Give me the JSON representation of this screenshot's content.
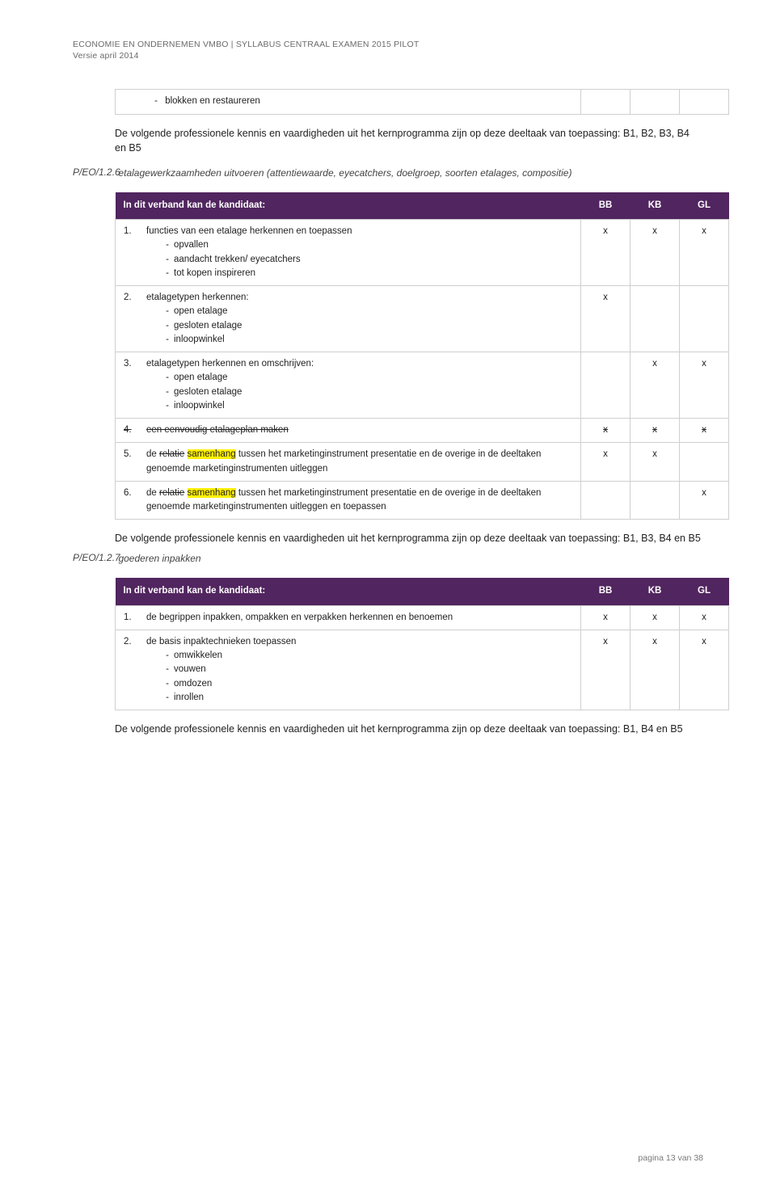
{
  "header": {
    "line1": "ECONOMIE EN ONDERNEMEN  VMBO | SYLLABUS CENTRAAL EXAMEN 2015 PILOT",
    "line2": "Versie april 2014"
  },
  "preblock": {
    "bullet1": "blokken en restaureren",
    "para": "De volgende professionele kennis en vaardigheden uit het kernprogramma zijn op deze deeltaak van toepassing: B1, B2, B3, B4 en B5"
  },
  "section126": {
    "code": "P/EO/1.2.6",
    "title": "etalagewerkzaamheden uitvoeren (attentiewaarde, eyecatchers, doelgroep, soorten etalages, compositie)"
  },
  "table_header": {
    "label": "In dit verband kan de kandidaat:",
    "col_bb": "BB",
    "col_kb": "KB",
    "col_gl": "GL"
  },
  "x": "x",
  "t126": {
    "r1": {
      "num": "1.",
      "text": "functies van een etalage herkennen en toepassen",
      "sub1": "opvallen",
      "sub2": "aandacht trekken/ eyecatchers",
      "sub3": "tot kopen inspireren",
      "bb": "x",
      "kb": "x",
      "gl": "x"
    },
    "r2": {
      "num": "2.",
      "text": "etalagetypen herkennen:",
      "sub1": "open etalage",
      "sub2": "gesloten etalage",
      "sub3": "inloopwinkel",
      "bb": "x",
      "kb": "",
      "gl": ""
    },
    "r3": {
      "num": "3.",
      "text": "etalagetypen herkennen en omschrijven:",
      "sub1": "open etalage",
      "sub2": "gesloten etalage",
      "sub3": "inloopwinkel",
      "bb": "",
      "kb": "x",
      "gl": "x"
    },
    "r4": {
      "num": "4.",
      "text": "een eenvoudig etalageplan maken",
      "bb": "x",
      "kb": "x",
      "gl": "x"
    },
    "r5": {
      "num": "5.",
      "pre": "de ",
      "strike": "relatie",
      "hl": "samenhang",
      "post": " tussen het marketinginstrument presentatie en de overige in de deeltaken genoemde marketinginstrumenten uitleggen",
      "bb": "x",
      "kb": "x",
      "gl": ""
    },
    "r6": {
      "num": "6.",
      "pre": "de ",
      "strike": "relatie",
      "hl": "samenhang",
      "post": " tussen het marketinginstrument presentatie en de overige in de deeltaken genoemde marketinginstrumenten uitleggen en toepassen",
      "bb": "",
      "kb": "",
      "gl": "x"
    }
  },
  "mid_para": "De volgende professionele kennis en vaardigheden uit het kernprogramma zijn op deze deeltaak van toepassing: B1, B3, B4 en B5",
  "section127": {
    "code": "P/EO/1.2.7",
    "title": "goederen inpakken"
  },
  "t127": {
    "r1": {
      "num": "1.",
      "text": "de begrippen inpakken, ompakken en verpakken herkennen en benoemen",
      "bb": "x",
      "kb": "x",
      "gl": "x"
    },
    "r2": {
      "num": "2.",
      "text": "de basis inpaktechnieken toepassen",
      "sub1": "omwikkelen",
      "sub2": "vouwen",
      "sub3": "omdozen",
      "sub4": "inrollen",
      "bb": "x",
      "kb": "x",
      "gl": "x"
    }
  },
  "end_para": "De volgende professionele kennis en vaardigheden uit het kernprogramma zijn op deze deeltaak van toepassing: B1, B4 en B5",
  "footer": "pagina 13 van 38"
}
